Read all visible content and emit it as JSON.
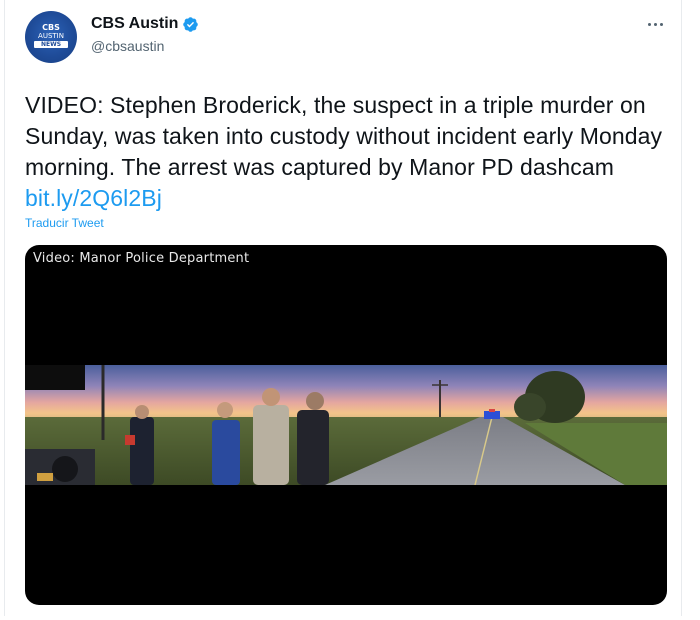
{
  "account": {
    "display_name": "CBS Austin",
    "handle": "@cbsaustin",
    "verified": true,
    "avatar": {
      "line1": "CBS",
      "line2": "AUSTIN",
      "line3": "NEWS"
    }
  },
  "tweet": {
    "text": "VIDEO: Stephen Broderick, the suspect in a triple murder on Sunday, was taken into custody without incident early Monday morning. The arrest was captured by Manor PD dashcam ",
    "link_text": "bit.ly/2Q6l2Bj",
    "translate_label": "Traducir Tweet"
  },
  "media": {
    "caption": "Video: Manor Police Department"
  },
  "icons": {
    "more": "more-horizontal-icon",
    "verified": "verified-badge-icon"
  },
  "colors": {
    "link": "#1d9bf0",
    "text": "#0f1419",
    "secondary": "#536471",
    "verified": "#1d9bf0"
  }
}
